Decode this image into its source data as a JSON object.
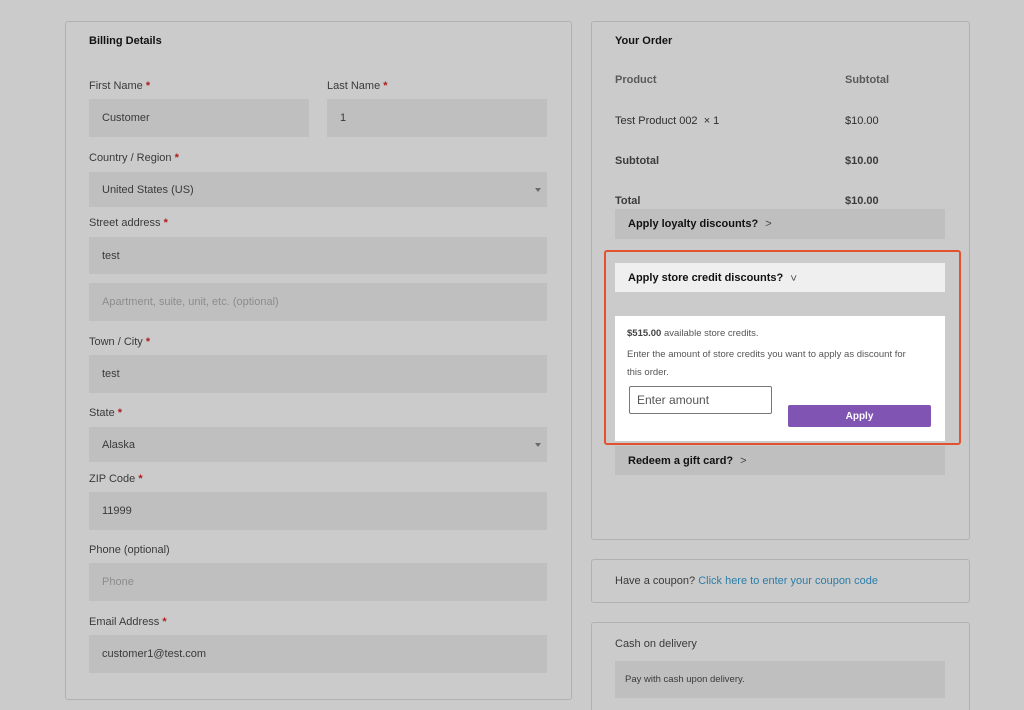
{
  "billing": {
    "title": "Billing Details",
    "required_mark": "*",
    "first_name": {
      "label": "First Name",
      "value": "Customer"
    },
    "last_name": {
      "label": "Last Name",
      "value": "1"
    },
    "country": {
      "label": "Country / Region",
      "value": "United States (US)"
    },
    "street": {
      "label": "Street address",
      "value": "test",
      "placeholder2": "Apartment, suite, unit, etc. (optional)"
    },
    "city": {
      "label": "Town / City",
      "value": "test"
    },
    "state": {
      "label": "State",
      "value": "Alaska"
    },
    "zip": {
      "label": "ZIP Code",
      "value": "11999"
    },
    "phone": {
      "label": "Phone (optional)",
      "placeholder": "Phone"
    },
    "email": {
      "label": "Email Address",
      "value": "customer1@test.com"
    }
  },
  "order": {
    "title": "Your Order",
    "col_product": "Product",
    "col_subtotal": "Subtotal",
    "item_name": "Test Product 002",
    "item_qty": "× 1",
    "item_price": "$10.00",
    "subtotal_label": "Subtotal",
    "subtotal_value": "$10.00",
    "total_label": "Total",
    "total_value": "$10.00",
    "loyalty_label": "Apply loyalty discounts?",
    "store_credit_label": "Apply store credit discounts?",
    "credit_amount": "$515.00",
    "credit_available": "available store credits.",
    "credit_instruction_1": "Enter the amount of store credits you want to apply as discount for",
    "credit_instruction_2": "this order.",
    "amount_placeholder": "Enter amount",
    "apply_label": "Apply",
    "gift_card_label": "Redeem a gift card?"
  },
  "coupon": {
    "prefix": "Have a coupon?",
    "link": "Click here to enter your coupon code"
  },
  "payment": {
    "method": "Cash on delivery",
    "description": "Pay with cash upon delivery."
  },
  "colors": {
    "accent": "#7f54b3",
    "highlight": "#e2522e",
    "link": "#2d7ea8",
    "required": "#b01c1c"
  },
  "icons": {
    "chevron_right": "chevron-right-icon",
    "chevron_down": "chevron-down-icon",
    "select_caret": "caret-down-icon"
  }
}
